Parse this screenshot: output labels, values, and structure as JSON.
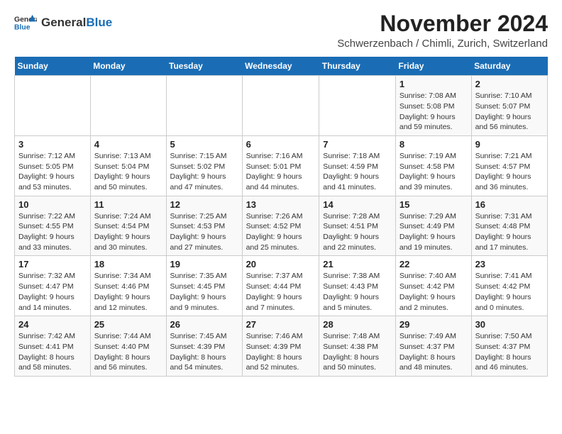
{
  "logo": {
    "text1": "General",
    "text2": "Blue"
  },
  "title": "November 2024",
  "subtitle": "Schwerzenbach / Chimli, Zurich, Switzerland",
  "weekdays": [
    "Sunday",
    "Monday",
    "Tuesday",
    "Wednesday",
    "Thursday",
    "Friday",
    "Saturday"
  ],
  "weeks": [
    [
      {
        "day": "",
        "info": ""
      },
      {
        "day": "",
        "info": ""
      },
      {
        "day": "",
        "info": ""
      },
      {
        "day": "",
        "info": ""
      },
      {
        "day": "",
        "info": ""
      },
      {
        "day": "1",
        "info": "Sunrise: 7:08 AM\nSunset: 5:08 PM\nDaylight: 9 hours and 59 minutes."
      },
      {
        "day": "2",
        "info": "Sunrise: 7:10 AM\nSunset: 5:07 PM\nDaylight: 9 hours and 56 minutes."
      }
    ],
    [
      {
        "day": "3",
        "info": "Sunrise: 7:12 AM\nSunset: 5:05 PM\nDaylight: 9 hours and 53 minutes."
      },
      {
        "day": "4",
        "info": "Sunrise: 7:13 AM\nSunset: 5:04 PM\nDaylight: 9 hours and 50 minutes."
      },
      {
        "day": "5",
        "info": "Sunrise: 7:15 AM\nSunset: 5:02 PM\nDaylight: 9 hours and 47 minutes."
      },
      {
        "day": "6",
        "info": "Sunrise: 7:16 AM\nSunset: 5:01 PM\nDaylight: 9 hours and 44 minutes."
      },
      {
        "day": "7",
        "info": "Sunrise: 7:18 AM\nSunset: 4:59 PM\nDaylight: 9 hours and 41 minutes."
      },
      {
        "day": "8",
        "info": "Sunrise: 7:19 AM\nSunset: 4:58 PM\nDaylight: 9 hours and 39 minutes."
      },
      {
        "day": "9",
        "info": "Sunrise: 7:21 AM\nSunset: 4:57 PM\nDaylight: 9 hours and 36 minutes."
      }
    ],
    [
      {
        "day": "10",
        "info": "Sunrise: 7:22 AM\nSunset: 4:55 PM\nDaylight: 9 hours and 33 minutes."
      },
      {
        "day": "11",
        "info": "Sunrise: 7:24 AM\nSunset: 4:54 PM\nDaylight: 9 hours and 30 minutes."
      },
      {
        "day": "12",
        "info": "Sunrise: 7:25 AM\nSunset: 4:53 PM\nDaylight: 9 hours and 27 minutes."
      },
      {
        "day": "13",
        "info": "Sunrise: 7:26 AM\nSunset: 4:52 PM\nDaylight: 9 hours and 25 minutes."
      },
      {
        "day": "14",
        "info": "Sunrise: 7:28 AM\nSunset: 4:51 PM\nDaylight: 9 hours and 22 minutes."
      },
      {
        "day": "15",
        "info": "Sunrise: 7:29 AM\nSunset: 4:49 PM\nDaylight: 9 hours and 19 minutes."
      },
      {
        "day": "16",
        "info": "Sunrise: 7:31 AM\nSunset: 4:48 PM\nDaylight: 9 hours and 17 minutes."
      }
    ],
    [
      {
        "day": "17",
        "info": "Sunrise: 7:32 AM\nSunset: 4:47 PM\nDaylight: 9 hours and 14 minutes."
      },
      {
        "day": "18",
        "info": "Sunrise: 7:34 AM\nSunset: 4:46 PM\nDaylight: 9 hours and 12 minutes."
      },
      {
        "day": "19",
        "info": "Sunrise: 7:35 AM\nSunset: 4:45 PM\nDaylight: 9 hours and 9 minutes."
      },
      {
        "day": "20",
        "info": "Sunrise: 7:37 AM\nSunset: 4:44 PM\nDaylight: 9 hours and 7 minutes."
      },
      {
        "day": "21",
        "info": "Sunrise: 7:38 AM\nSunset: 4:43 PM\nDaylight: 9 hours and 5 minutes."
      },
      {
        "day": "22",
        "info": "Sunrise: 7:40 AM\nSunset: 4:42 PM\nDaylight: 9 hours and 2 minutes."
      },
      {
        "day": "23",
        "info": "Sunrise: 7:41 AM\nSunset: 4:42 PM\nDaylight: 9 hours and 0 minutes."
      }
    ],
    [
      {
        "day": "24",
        "info": "Sunrise: 7:42 AM\nSunset: 4:41 PM\nDaylight: 8 hours and 58 minutes."
      },
      {
        "day": "25",
        "info": "Sunrise: 7:44 AM\nSunset: 4:40 PM\nDaylight: 8 hours and 56 minutes."
      },
      {
        "day": "26",
        "info": "Sunrise: 7:45 AM\nSunset: 4:39 PM\nDaylight: 8 hours and 54 minutes."
      },
      {
        "day": "27",
        "info": "Sunrise: 7:46 AM\nSunset: 4:39 PM\nDaylight: 8 hours and 52 minutes."
      },
      {
        "day": "28",
        "info": "Sunrise: 7:48 AM\nSunset: 4:38 PM\nDaylight: 8 hours and 50 minutes."
      },
      {
        "day": "29",
        "info": "Sunrise: 7:49 AM\nSunset: 4:37 PM\nDaylight: 8 hours and 48 minutes."
      },
      {
        "day": "30",
        "info": "Sunrise: 7:50 AM\nSunset: 4:37 PM\nDaylight: 8 hours and 46 minutes."
      }
    ]
  ]
}
